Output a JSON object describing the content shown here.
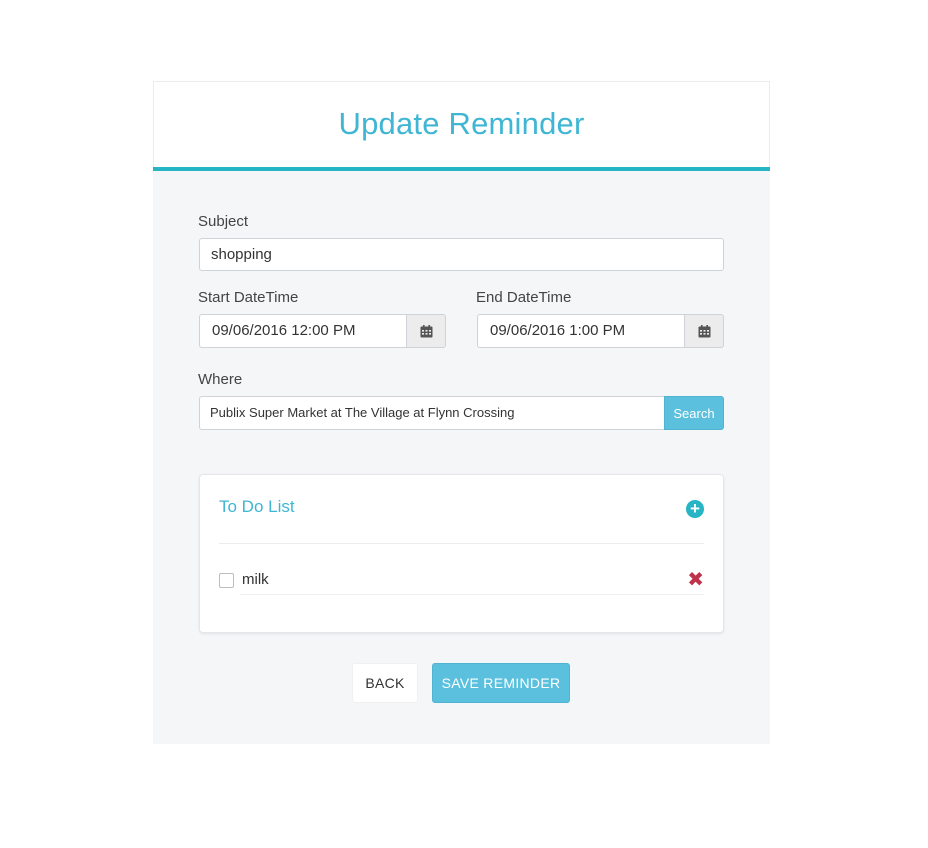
{
  "form": {
    "title": "Update Reminder",
    "subject": {
      "label": "Subject",
      "value": "shopping"
    },
    "start": {
      "label": "Start DateTime",
      "value": "09/06/2016 12:00 PM",
      "icon": "calendar-icon"
    },
    "end": {
      "label": "End DateTime",
      "value": "09/06/2016 1:00 PM",
      "icon": "calendar-icon"
    },
    "where": {
      "label": "Where",
      "value": "Publix Super Market at The Village at Flynn Crossing",
      "search_label": "Search"
    }
  },
  "todo": {
    "title": "To Do List",
    "add_icon": "plus-circle-icon",
    "items": [
      {
        "text": "milk",
        "checked": false,
        "delete_icon": "close-icon"
      }
    ]
  },
  "actions": {
    "back_label": "BACK",
    "save_label": "SAVE REMINDER"
  },
  "colors": {
    "accent": "#3fb6d3",
    "header_bar": "#27b4c5",
    "button_primary": "#5bc0de",
    "delete": "#c0324a",
    "card_background": "#f5f6f8"
  }
}
